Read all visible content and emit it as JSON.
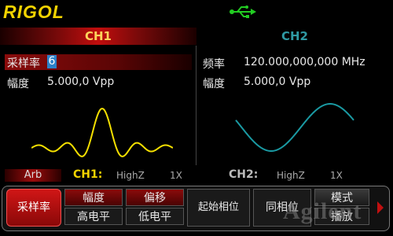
{
  "header": {
    "brand": "RIGOL",
    "usb_icon": "usb-icon",
    "colors": {
      "brand": "#f3d300",
      "usb": "#22cc22"
    }
  },
  "tabs": [
    {
      "label": "CH1",
      "active": true
    },
    {
      "label": "CH2",
      "active": false
    }
  ],
  "ch1": {
    "sample_rate_label": "采样率",
    "sample_rate_input": "6",
    "amplitude_label": "幅度",
    "amplitude_value": "5.000,0 Vpp",
    "waveform": "arb-sinc",
    "wave_color": "#f5e000"
  },
  "ch2": {
    "frequency_label": "频率",
    "frequency_value": "120.000,000,000 MHz",
    "amplitude_label": "幅度",
    "amplitude_value": "5.000,0 Vpp",
    "waveform": "sine",
    "wave_color": "#1a9aa3"
  },
  "status": {
    "mode": "Arb",
    "ch1_tag": "CH1:",
    "ch1_impedance": "HighZ",
    "ch1_multiplier": "1X",
    "ch2_tag": "CH2:",
    "ch2_impedance": "HighZ",
    "ch2_multiplier": "1X"
  },
  "softkeys": {
    "sample_rate": "采样率",
    "amplitude": "幅度",
    "high_level": "高电平",
    "offset": "偏移",
    "low_level": "低电平",
    "start_phase": "起始相位",
    "align_phase": "同相位",
    "mode": "模式",
    "play": "播放"
  },
  "watermark": "Agilent"
}
